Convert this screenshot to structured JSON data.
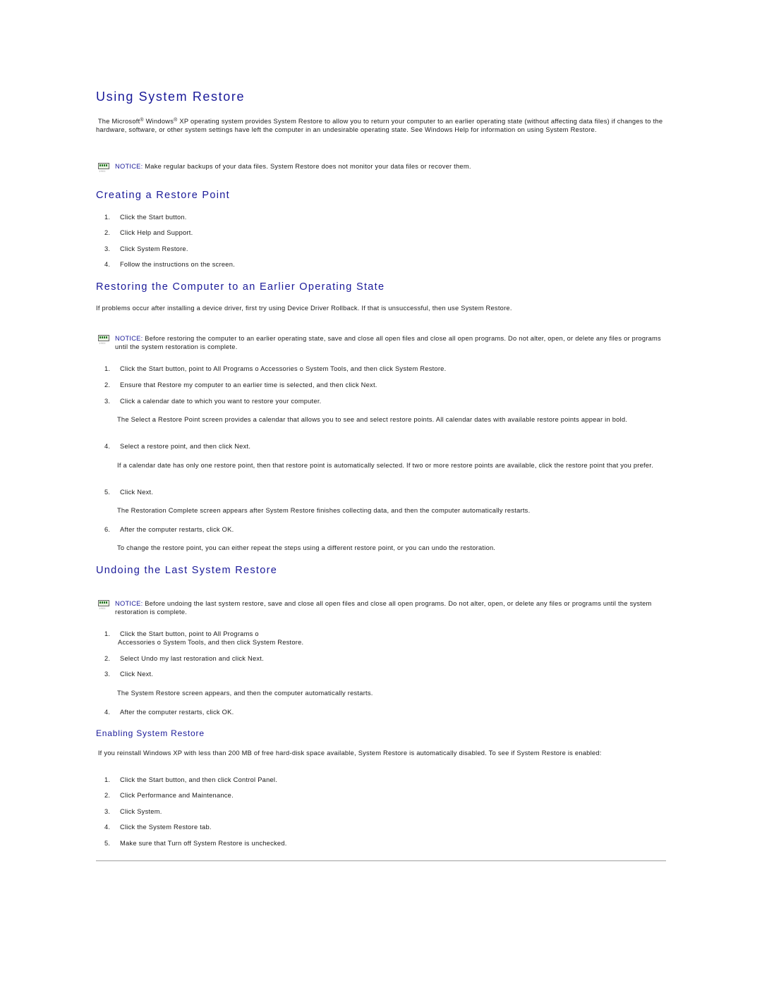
{
  "title": "Using System Restore",
  "intro": {
    "part1": "The Microsoft",
    "reg1": "®",
    "part2": " Windows",
    "reg2": "®",
    "part3": " XP operating system provides System Restore to allow you to return your computer to an earlier operating state (without affecting data files) if changes to the hardware, software, or other system settings have left the computer in an undesirable operating state. See Windows Help for information on using System Restore."
  },
  "notice_label": "NOTICE:",
  "notices": [
    {
      "icon": "notice-icon",
      "text": " Make regular backups of your data files. System Restore does not monitor your data files or recover them."
    },
    {
      "icon": "notice-icon",
      "text": " Before restoring the computer to an earlier operating state, save and close all open files and close all open programs. Do not alter, open, or delete any files or programs until the system restoration is complete."
    },
    {
      "icon": "notice-icon",
      "text": " Before undoing the last system restore, save and close all open files and close all open programs. Do not alter, open, or delete any files or programs until the system restoration is complete."
    }
  ],
  "sections": {
    "creating": {
      "heading": "Creating a Restore Point",
      "steps": [
        {
          "num": "1.",
          "text": "Click the Start button."
        },
        {
          "num": "2.",
          "text": "Click Help and Support."
        },
        {
          "num": "3.",
          "text": "Click System Restore."
        },
        {
          "num": "4.",
          "text": "Follow the instructions on the screen."
        }
      ]
    },
    "restoring": {
      "heading": "Restoring the Computer to an Earlier Operating State",
      "intro": "If problems occur after installing a device driver, first try using Device Driver Rollback. If that is unsuccessful, then use System Restore.",
      "steps": [
        {
          "num": "1.",
          "text": "Click the Start button, point to All Programs o Accessories o System Tools, and then click System Restore."
        },
        {
          "num": "2.",
          "text": "Ensure that Restore my computer to an earlier time is selected, and then click Next."
        },
        {
          "num": "3.",
          "text": "Click a calendar date to which you want to restore your computer."
        },
        {
          "num": "4.",
          "text": "Select a restore point, and then click Next."
        },
        {
          "num": "5.",
          "text": "Click Next."
        },
        {
          "num": "6.",
          "text": "After the computer restarts, click OK."
        }
      ],
      "notes": [
        "The Select a Restore Point screen provides a calendar that allows you to see and select restore points. All calendar dates with available restore points appear in bold.",
        "If a calendar date has only one restore point, then that restore point is automatically selected. If two or more restore points are available, click the restore point that you prefer.",
        "The Restoration Complete screen appears after System Restore finishes collecting data, and then the computer automatically restarts.",
        "To change the restore point, you can either repeat the steps using a different restore point, or you can undo the restoration."
      ]
    },
    "undoing": {
      "heading": "Undoing the Last System Restore",
      "steps": [
        {
          "num": "1.",
          "line1": "Click the Start button, point to All Programs  o",
          "line2": "Accessories  o System Tools, and then click System Restore."
        },
        {
          "num": "2.",
          "text": "Select Undo my last restoration and click Next."
        },
        {
          "num": "3.",
          "text": "Click Next."
        },
        {
          "num": "4.",
          "text": "After the computer restarts, click OK."
        }
      ],
      "note": "The System Restore screen appears, and then the computer automatically restarts."
    },
    "enabling": {
      "heading": "Enabling System Restore",
      "intro": "If you reinstall Windows XP with less than 200 MB of free hard-disk space available, System Restore is automatically disabled. To see if System Restore is enabled:",
      "steps": [
        {
          "num": "1.",
          "text": "Click the Start button, and then click Control Panel."
        },
        {
          "num": "2.",
          "text": "Click Performance and Maintenance."
        },
        {
          "num": "3.",
          "text": "Click System."
        },
        {
          "num": "4.",
          "text": "Click the System Restore tab."
        },
        {
          "num": "5.",
          "text": "Make sure that Turn off System Restore is unchecked."
        }
      ]
    }
  }
}
